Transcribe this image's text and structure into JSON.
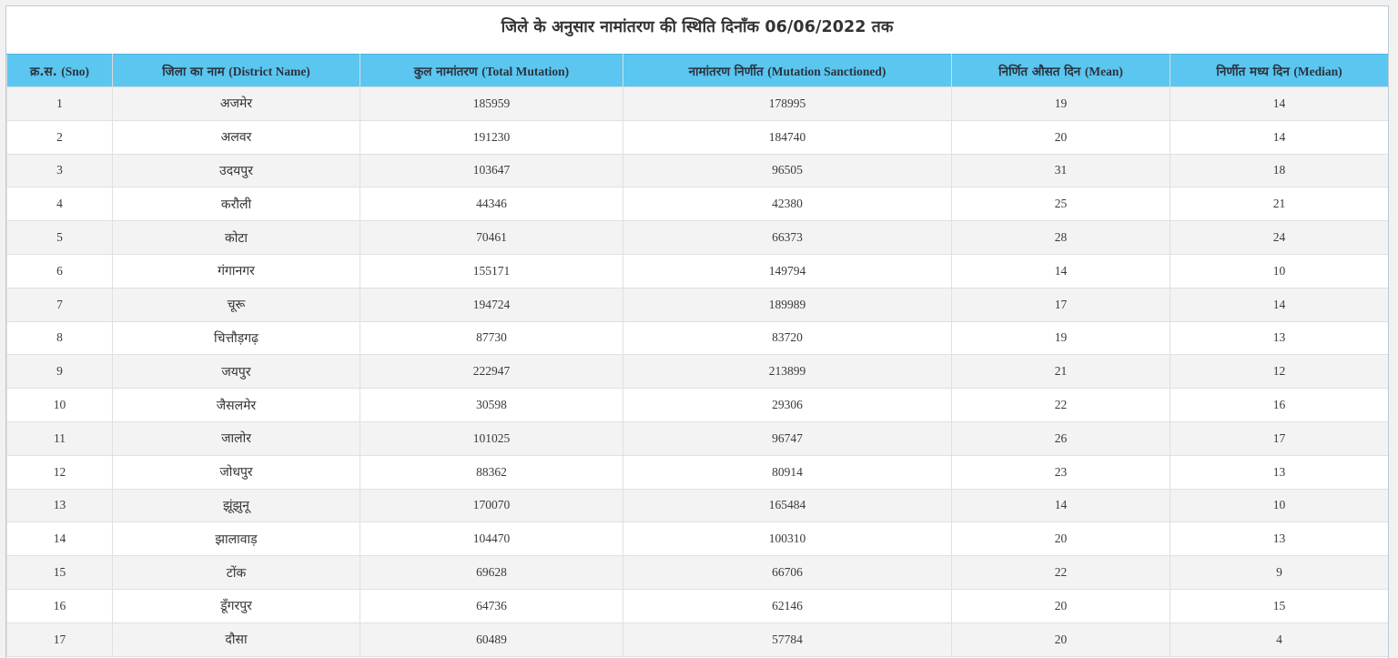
{
  "page": {
    "title": "जिले के अनुसार नामांतरण की स्थिति दिनाँक 06/06/2022 तक"
  },
  "colors": {
    "header_bg": "#5bc6ef",
    "odd_row_bg": "#f3f3f3",
    "even_row_bg": "#ffffff"
  },
  "table": {
    "headers": [
      {
        "hi": "क्र.स.",
        "en": "(Sno)"
      },
      {
        "hi": "जिला का नाम",
        "en": "(District Name)"
      },
      {
        "hi": "कुल नामांतरण",
        "en": "(Total Mutation)"
      },
      {
        "hi": "नामांतरण निर्णीत",
        "en": "(Mutation Sanctioned)"
      },
      {
        "hi": "निर्णित औसत दिन",
        "en": "(Mean)"
      },
      {
        "hi": "निर्णीत मध्य दिन",
        "en": "(Median)"
      }
    ],
    "rows": [
      {
        "sno": "1",
        "district": "अजमेर",
        "total": "185959",
        "sanctioned": "178995",
        "mean": "19",
        "median": "14"
      },
      {
        "sno": "2",
        "district": "अलवर",
        "total": "191230",
        "sanctioned": "184740",
        "mean": "20",
        "median": "14"
      },
      {
        "sno": "3",
        "district": "उदयपुर",
        "total": "103647",
        "sanctioned": "96505",
        "mean": "31",
        "median": "18"
      },
      {
        "sno": "4",
        "district": "करौली",
        "total": "44346",
        "sanctioned": "42380",
        "mean": "25",
        "median": "21"
      },
      {
        "sno": "5",
        "district": "कोटा",
        "total": "70461",
        "sanctioned": "66373",
        "mean": "28",
        "median": "24"
      },
      {
        "sno": "6",
        "district": "गंगानगर",
        "total": "155171",
        "sanctioned": "149794",
        "mean": "14",
        "median": "10"
      },
      {
        "sno": "7",
        "district": "चूरू",
        "total": "194724",
        "sanctioned": "189989",
        "mean": "17",
        "median": "14"
      },
      {
        "sno": "8",
        "district": "चित्तौड़गढ़",
        "total": "87730",
        "sanctioned": "83720",
        "mean": "19",
        "median": "13"
      },
      {
        "sno": "9",
        "district": "जयपुर",
        "total": "222947",
        "sanctioned": "213899",
        "mean": "21",
        "median": "12"
      },
      {
        "sno": "10",
        "district": "जैसलमेर",
        "total": "30598",
        "sanctioned": "29306",
        "mean": "22",
        "median": "16"
      },
      {
        "sno": "11",
        "district": "जालोर",
        "total": "101025",
        "sanctioned": "96747",
        "mean": "26",
        "median": "17"
      },
      {
        "sno": "12",
        "district": "जोधपुर",
        "total": "88362",
        "sanctioned": "80914",
        "mean": "23",
        "median": "13"
      },
      {
        "sno": "13",
        "district": "झूंझुनू",
        "total": "170070",
        "sanctioned": "165484",
        "mean": "14",
        "median": "10"
      },
      {
        "sno": "14",
        "district": "झालावाड़",
        "total": "104470",
        "sanctioned": "100310",
        "mean": "20",
        "median": "13"
      },
      {
        "sno": "15",
        "district": "टोंक",
        "total": "69628",
        "sanctioned": "66706",
        "mean": "22",
        "median": "9"
      },
      {
        "sno": "16",
        "district": "डूँगरपुर",
        "total": "64736",
        "sanctioned": "62146",
        "mean": "20",
        "median": "15"
      },
      {
        "sno": "17",
        "district": "दौसा",
        "total": "60489",
        "sanctioned": "57784",
        "mean": "20",
        "median": "4"
      }
    ]
  }
}
